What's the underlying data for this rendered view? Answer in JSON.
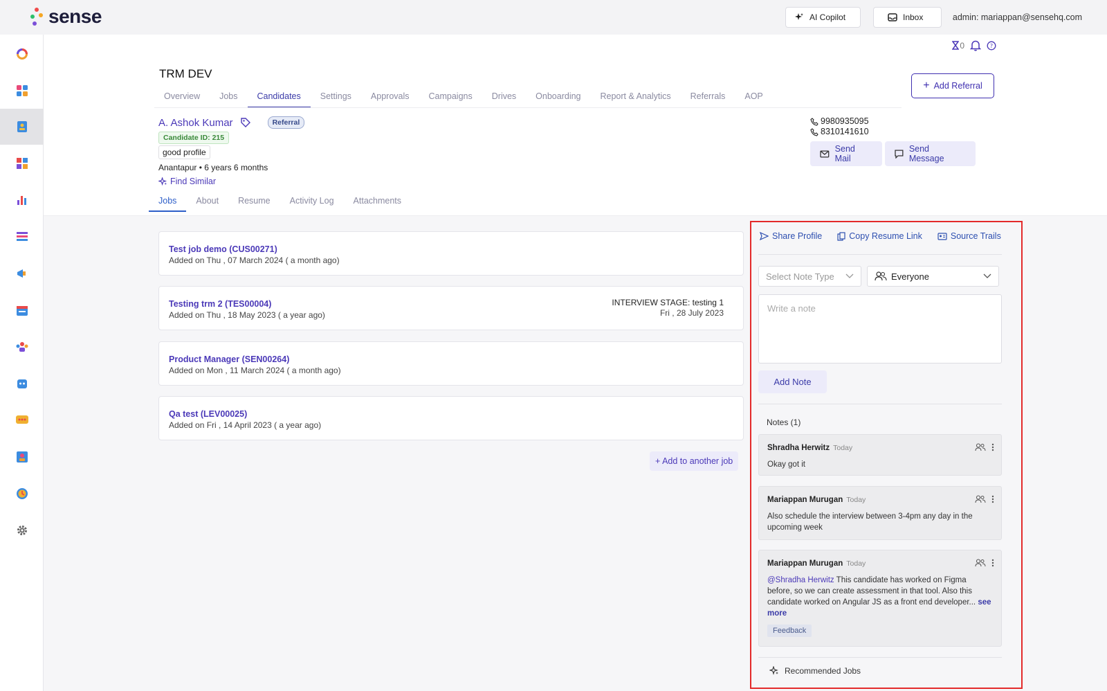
{
  "app": {
    "logo_text": "sense"
  },
  "topbar": {
    "copilot_label": "AI Copilot",
    "inbox_label": "Inbox",
    "admin_text": "admin: mariappan@sensehq.com"
  },
  "subbar": {
    "hourglass_count": "0"
  },
  "page": {
    "title": "TRM DEV",
    "add_referral_label": "Add Referral"
  },
  "nav_tabs": [
    "Overview",
    "Jobs",
    "Candidates",
    "Settings",
    "Approvals",
    "Campaigns",
    "Drives",
    "Onboarding",
    "Report & Analytics",
    "Referrals",
    "AOP"
  ],
  "candidate": {
    "name": "A. Ashok Kumar",
    "badge": "Referral",
    "id_text": "Candidate ID: 215",
    "tag": "good profile",
    "location_line": "Anantapur • 6 years 6 months",
    "find_similar": "Find Similar",
    "phones": [
      "9980935095",
      "8310141610"
    ],
    "send_mail": "Send Mail",
    "send_message": "Send Message"
  },
  "sub_tabs": [
    "Jobs",
    "About",
    "Resume",
    "Activity Log",
    "Attachments"
  ],
  "jobs": [
    {
      "title": "Test job demo (CUS00271)",
      "added": "Added on Thu , 07 March 2024 ( a month ago)",
      "stage": "",
      "stage_date": ""
    },
    {
      "title": "Testing trm 2 (TES00004)",
      "added": "Added on Thu , 18 May 2023 ( a year ago)",
      "stage": "INTERVIEW STAGE: testing 1",
      "stage_date": "Fri , 28 July 2023"
    },
    {
      "title": "Product Manager (SEN00264)",
      "added": "Added on Mon , 11 March 2024 ( a month ago)",
      "stage": "",
      "stage_date": ""
    },
    {
      "title": "Qa test (LEV00025)",
      "added": "Added on Fri , 14 April 2023 ( a year ago)",
      "stage": "",
      "stage_date": ""
    }
  ],
  "add_job_label": "+ Add to another job",
  "panel": {
    "share_profile": "Share Profile",
    "copy_resume": "Copy Resume Link",
    "source_trails": "Source Trails",
    "note_type_placeholder": "Select Note Type",
    "visibility": "Everyone",
    "note_placeholder": "Write a note",
    "add_note": "Add Note",
    "notes_header": "Notes (1)",
    "notes": [
      {
        "author": "Shradha Herwitz",
        "time": "Today",
        "text": "Okay got it"
      },
      {
        "author": "Mariappan Murugan",
        "time": "Today",
        "text": "Also schedule the interview between 3-4pm any day in the upcoming week"
      },
      {
        "author": "Mariappan Murugan",
        "time": "Today",
        "mention": "@Shradha Herwitz",
        "text": " This candidate has worked on Figma before, so we can create assessment in that tool. Also this candidate worked on Angular JS as a front end developer...",
        "see_more": "see more",
        "tag": "Feedback"
      }
    ],
    "recommended_jobs": "Recommended Jobs"
  },
  "colors": {
    "accent": "#3f2fb0",
    "highlight_border": "#e32a2a"
  }
}
